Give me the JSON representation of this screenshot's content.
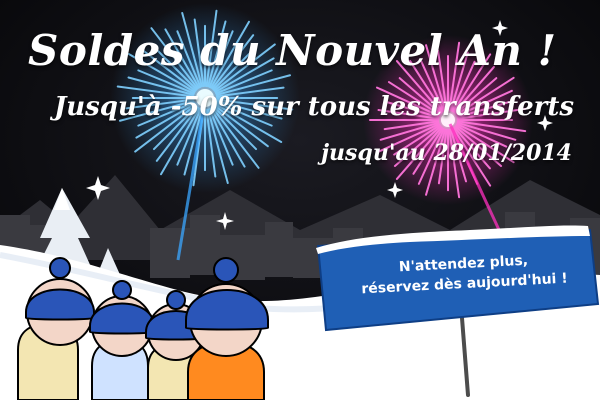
{
  "headline": "Soldes du Nouvel An !",
  "subline": "Jusqu'à -50% sur tous les transferts",
  "dateline": "jusqu'au 28/01/2014",
  "cta": {
    "line1": "N'attendez plus,",
    "line2": "réservez dès aujourd'hui !"
  },
  "colors": {
    "sky": "#0b0b10",
    "snow": "#ffffff",
    "sign": "#1f5fb5",
    "firework_blue": "#3aa6ff",
    "firework_pink": "#ff2fbf",
    "hat": "#2a55b8"
  }
}
